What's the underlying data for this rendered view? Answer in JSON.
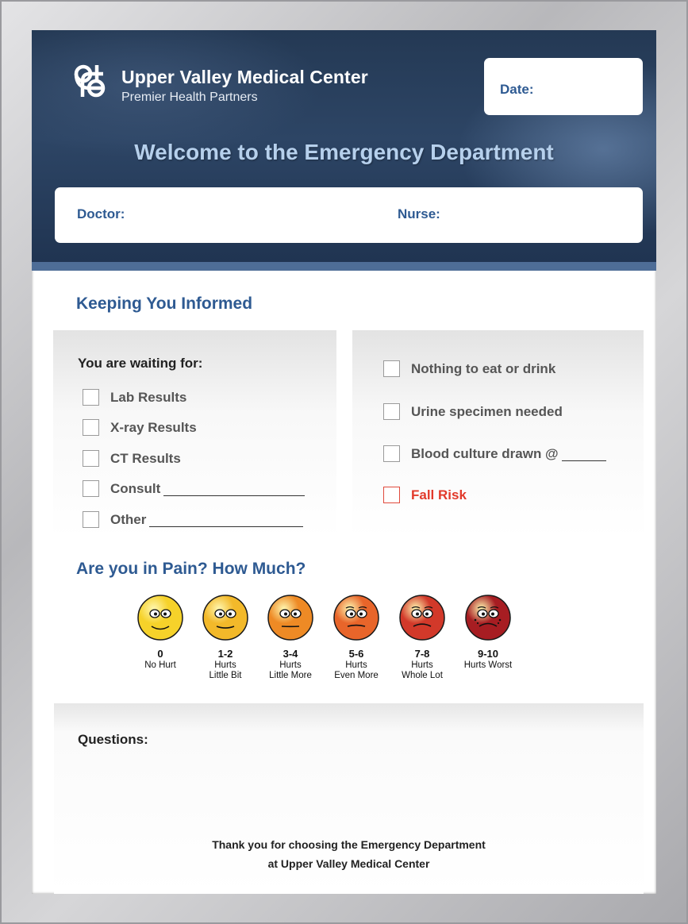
{
  "header": {
    "org_name": "Upper Valley Medical Center",
    "org_sub": "Premier Health Partners",
    "date_label": "Date:",
    "welcome": "Welcome to the Emergency Department",
    "doctor_label": "Doctor:",
    "nurse_label": "Nurse:"
  },
  "informed": {
    "title": "Keeping You Informed",
    "waiting_title": "You are waiting for:",
    "waiting_items": [
      "Lab Results",
      "X-ray Results",
      "CT Results",
      "Consult",
      "Other"
    ],
    "status_items": [
      "Nothing to eat or drink",
      "Urine specimen needed",
      "Blood culture drawn @",
      "Fall Risk"
    ]
  },
  "pain": {
    "title": "Are you in Pain? How Much?",
    "scale": [
      {
        "num": "0",
        "line1": "No Hurt",
        "line2": "",
        "color": "#f6d22a"
      },
      {
        "num": "1-2",
        "line1": "Hurts",
        "line2": "Little Bit",
        "color": "#f3b92a"
      },
      {
        "num": "3-4",
        "line1": "Hurts",
        "line2": "Little More",
        "color": "#ee8a25"
      },
      {
        "num": "5-6",
        "line1": "Hurts",
        "line2": "Even More",
        "color": "#e8652a"
      },
      {
        "num": "7-8",
        "line1": "Hurts",
        "line2": "Whole Lot",
        "color": "#d2392a"
      },
      {
        "num": "9-10",
        "line1": "Hurts Worst",
        "line2": "",
        "color": "#a71d22"
      }
    ]
  },
  "questions": {
    "label": "Questions:",
    "thanks_line1": "Thank you for choosing the Emergency Department",
    "thanks_line2": "at Upper Valley Medical Center"
  },
  "colors": {
    "header_navy": "#243954",
    "accent_blue": "#2e5a92",
    "fall_risk_red": "#e23a2b"
  }
}
